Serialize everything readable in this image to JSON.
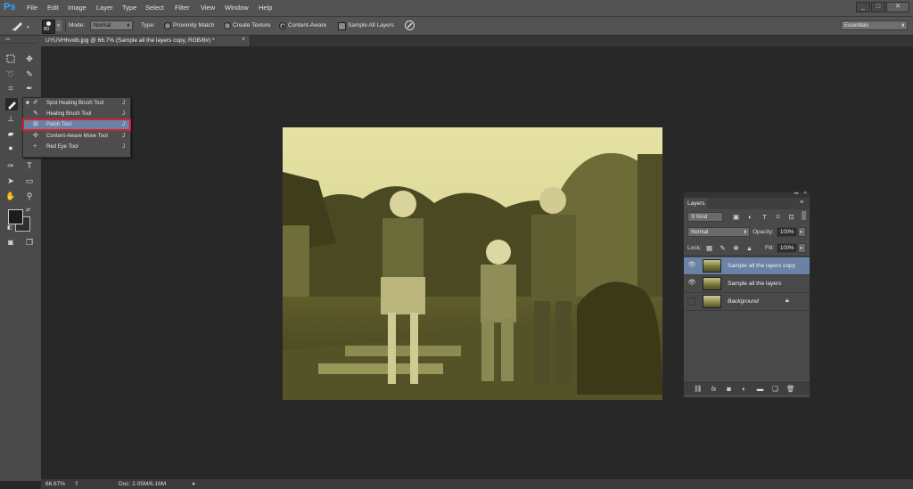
{
  "app": {
    "logo": "Ps"
  },
  "menu": [
    "File",
    "Edit",
    "Image",
    "Layer",
    "Type",
    "Select",
    "Filter",
    "View",
    "Window",
    "Help"
  ],
  "window_controls": {
    "minimize": "_",
    "restore": "□",
    "close": "✕"
  },
  "options_bar": {
    "brush_size": "80",
    "mode_label": "Mode:",
    "mode_value": "Normal",
    "type_label": "Type:",
    "type_options": [
      {
        "label": "Proximity Match",
        "selected": false
      },
      {
        "label": "Create Texture",
        "selected": false
      },
      {
        "label": "Content-Aware",
        "selected": true
      }
    ],
    "sample_all_layers_label": "Sample All Layers",
    "sample_all_layers_checked": false,
    "workspace": "Essentials"
  },
  "document": {
    "tab_title": "UYUVHhvxlb.jpg @ 66.7% (Sample all the layers copy, RGB/8#) *",
    "tab_close": "×"
  },
  "flyout": {
    "items": [
      {
        "icon": "spot-healing-brush-icon",
        "label": "Spot Healing Brush Tool",
        "shortcut": "J",
        "current": true,
        "selected": false
      },
      {
        "icon": "healing-brush-icon",
        "label": "Healing Brush Tool",
        "shortcut": "J",
        "current": false,
        "selected": false
      },
      {
        "icon": "patch-icon",
        "label": "Patch Tool",
        "shortcut": "J",
        "current": false,
        "selected": true
      },
      {
        "icon": "content-aware-move-icon",
        "label": "Content-Aware Move Tool",
        "shortcut": "J",
        "current": false,
        "selected": false
      },
      {
        "icon": "red-eye-icon",
        "label": "Red Eye Tool",
        "shortcut": "J",
        "current": false,
        "selected": false
      }
    ]
  },
  "layers_panel": {
    "title": "Layers",
    "filter_kind": "Kind",
    "blend_mode": "Normal",
    "opacity_label": "Opacity:",
    "opacity_value": "100%",
    "lock_label": "Lock:",
    "fill_label": "Fill:",
    "fill_value": "100%",
    "layers": [
      {
        "name": "Sample all the layers copy",
        "visible": true,
        "selected": true,
        "locked": false
      },
      {
        "name": "Sample all the layers",
        "visible": true,
        "selected": false,
        "locked": false
      },
      {
        "name": "Background",
        "visible": false,
        "selected": false,
        "locked": true
      }
    ]
  },
  "status_bar": {
    "zoom": "66.67%",
    "doc_info": "Doc: 2.05M/6.16M"
  },
  "colors": {
    "accent_selection": "#6b82a6",
    "highlight_box": "#d0222e",
    "ps_blue": "#31a8ff"
  }
}
